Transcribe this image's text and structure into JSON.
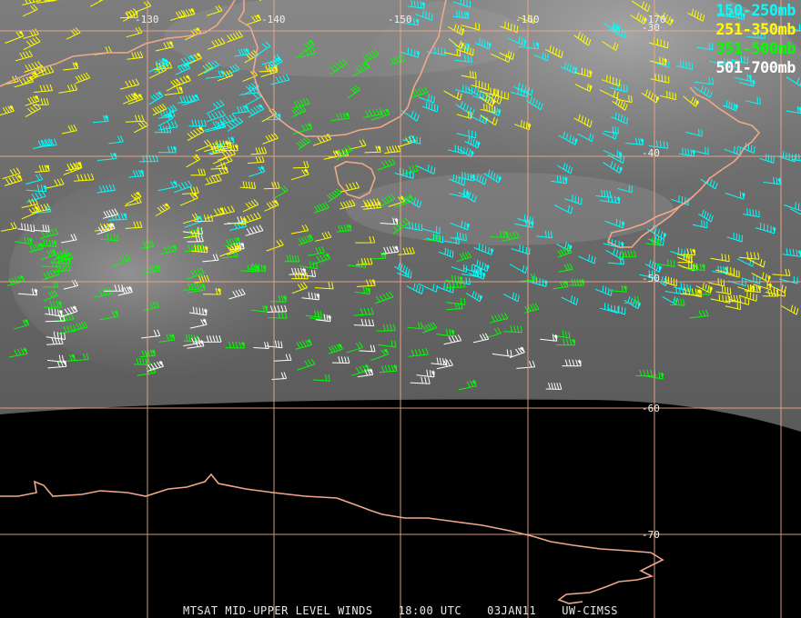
{
  "map": {
    "longitude_labels": [
      "-130",
      "-140",
      "-150",
      "-160",
      "-170"
    ],
    "latitude_labels": [
      "-30",
      "-40",
      "-50",
      "-60",
      "-70"
    ],
    "gridline_color": "#f0a88a",
    "coastline_color": "#f0a88a"
  },
  "legend": [
    {
      "label": "150-250mb",
      "color": "#00ffff"
    },
    {
      "label": "251-350mb",
      "color": "#ffff00"
    },
    {
      "label": "351-500mb",
      "color": "#00ff00"
    },
    {
      "label": "501-700mb",
      "color": "#ffffff"
    }
  ],
  "footer": {
    "product": "MTSAT MID-UPPER LEVEL WINDS",
    "time": "18:00 UTC",
    "date": "03JAN11",
    "source": "UW-CIMSS"
  }
}
